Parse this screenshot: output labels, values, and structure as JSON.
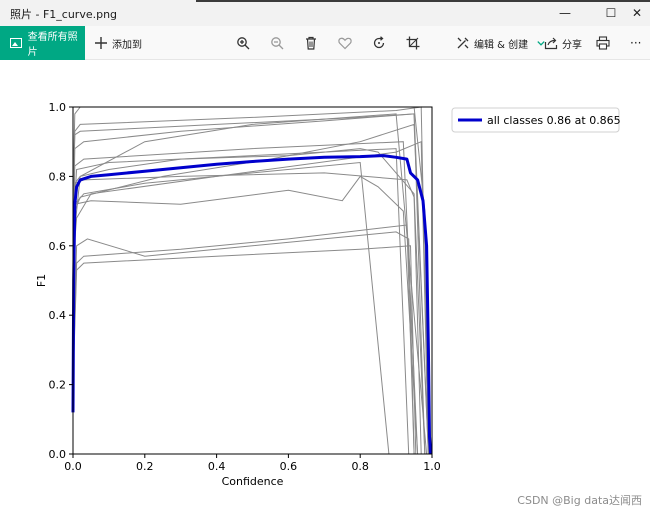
{
  "window": {
    "title": "照片 - F1_curve.png",
    "controls": {
      "minimize": "—",
      "maximize": "☐",
      "close": "✕"
    }
  },
  "toolbar": {
    "all_photos_label": "查看所有照片",
    "add_to_label": "添加到",
    "edit_create_label": "编辑 & 创建",
    "share_label": "分享",
    "more_label": "···",
    "accent": "#00a884",
    "icons": [
      "zoom-in-icon",
      "zoom-out-icon",
      "delete-icon",
      "heart-icon",
      "rotate-icon",
      "crop-icon",
      "edit-icon",
      "share-icon",
      "print-icon"
    ]
  },
  "chart_data": {
    "type": "line",
    "xlabel": "Confidence",
    "ylabel": "F1",
    "xlim": [
      0,
      1
    ],
    "ylim": [
      0,
      1
    ],
    "xticks": [
      "0.0",
      "0.2",
      "0.4",
      "0.6",
      "0.8",
      "1.0"
    ],
    "yticks": [
      "0.0",
      "0.2",
      "0.4",
      "0.6",
      "0.8",
      "1.0"
    ],
    "grid": false,
    "legend_position": "outside-top-right",
    "series": [
      {
        "name": "all classes 0.86 at 0.865",
        "color": "#0000cc",
        "x": [
          0.0,
          0.002,
          0.005,
          0.01,
          0.02,
          0.05,
          0.1,
          0.2,
          0.3,
          0.4,
          0.5,
          0.6,
          0.7,
          0.8,
          0.865,
          0.9,
          0.93,
          0.94,
          0.96,
          0.975,
          0.985,
          0.99,
          0.993,
          0.996
        ],
        "y": [
          0.12,
          0.5,
          0.72,
          0.77,
          0.79,
          0.8,
          0.805,
          0.815,
          0.825,
          0.835,
          0.843,
          0.85,
          0.855,
          0.857,
          0.86,
          0.855,
          0.85,
          0.81,
          0.79,
          0.73,
          0.6,
          0.3,
          0.05,
          0.0
        ]
      }
    ],
    "class_curves": {
      "color": "#8a8a8a",
      "lines": [
        {
          "x": [
            0.0,
            0.005,
            0.02,
            0.3,
            0.6,
            0.85,
            0.95,
            0.98,
            0.99
          ],
          "y": [
            0.75,
            0.98,
            1.0,
            1.0,
            1.0,
            1.0,
            1.0,
            0.7,
            0.0
          ]
        },
        {
          "x": [
            0.0,
            0.005,
            0.02,
            0.5,
            0.9,
            0.97,
            0.99
          ],
          "y": [
            0.7,
            0.93,
            0.95,
            0.97,
            0.99,
            1.0,
            0.0
          ]
        },
        {
          "x": [
            0.0,
            0.005,
            0.02,
            0.4,
            0.8,
            0.95,
            0.99
          ],
          "y": [
            0.7,
            0.92,
            0.93,
            0.95,
            0.97,
            0.98,
            0.0
          ]
        },
        {
          "x": [
            0.0,
            0.005,
            0.03,
            0.3,
            0.7,
            0.95,
            0.98
          ],
          "y": [
            0.6,
            0.88,
            0.9,
            0.93,
            0.96,
            0.98,
            0.0
          ]
        },
        {
          "x": [
            0.0,
            0.005,
            0.03,
            0.5,
            0.92,
            0.96
          ],
          "y": [
            0.55,
            0.83,
            0.85,
            0.88,
            0.9,
            0.0
          ]
        },
        {
          "x": [
            0.0,
            0.005,
            0.03,
            0.2,
            0.5,
            0.8,
            0.88
          ],
          "y": [
            0.5,
            0.72,
            0.75,
            0.78,
            0.81,
            0.84,
            0.0
          ]
        },
        {
          "x": [
            0.0,
            0.005,
            0.03,
            0.3,
            0.7,
            0.93,
            0.95,
            0.97
          ],
          "y": [
            0.45,
            0.78,
            0.79,
            0.8,
            0.81,
            0.79,
            0.74,
            0.0
          ]
        },
        {
          "x": [
            0.0,
            0.005,
            0.05,
            0.3,
            0.6,
            0.75,
            0.8,
            0.85,
            0.92,
            0.96
          ],
          "y": [
            0.35,
            0.72,
            0.73,
            0.72,
            0.76,
            0.73,
            0.8,
            0.77,
            0.7,
            0.0
          ]
        },
        {
          "x": [
            0.0,
            0.01,
            0.04,
            0.2,
            0.5,
            0.9,
            0.935,
            0.95
          ],
          "y": [
            0.25,
            0.6,
            0.62,
            0.57,
            0.6,
            0.64,
            0.62,
            0.0
          ]
        },
        {
          "x": [
            0.0,
            0.01,
            0.03,
            0.3,
            0.6,
            0.93,
            0.95
          ],
          "y": [
            0.22,
            0.55,
            0.57,
            0.59,
            0.62,
            0.66,
            0.0
          ]
        },
        {
          "x": [
            0.0,
            0.01,
            0.03,
            0.4,
            0.8,
            0.94,
            0.955
          ],
          "y": [
            0.2,
            0.53,
            0.55,
            0.57,
            0.59,
            0.6,
            0.0
          ]
        },
        {
          "x": [
            0.0,
            0.005,
            0.02,
            0.1,
            0.3,
            0.6,
            0.8,
            0.85,
            0.95,
            0.98
          ],
          "y": [
            0.5,
            0.65,
            0.8,
            0.82,
            0.85,
            0.86,
            0.88,
            0.87,
            0.75,
            0.0
          ]
        },
        {
          "x": [
            0.0,
            0.005,
            0.02,
            0.2,
            0.5,
            0.9,
            0.985
          ],
          "y": [
            0.6,
            0.78,
            0.8,
            0.9,
            0.95,
            0.98,
            0.0
          ]
        },
        {
          "x": [
            0.0,
            0.01,
            0.05,
            0.4,
            0.9,
            0.97,
            0.99
          ],
          "y": [
            0.55,
            0.68,
            0.75,
            0.8,
            0.87,
            0.9,
            0.0
          ]
        },
        {
          "x": [
            0.0,
            0.01,
            0.1,
            0.5,
            0.9,
            0.935
          ],
          "y": [
            0.65,
            0.82,
            0.84,
            0.86,
            0.88,
            0.0
          ]
        },
        {
          "x": [
            0.0,
            0.005,
            0.02,
            0.25,
            0.55,
            0.8,
            0.95,
            0.99
          ],
          "y": [
            0.4,
            0.7,
            0.74,
            0.8,
            0.85,
            0.9,
            0.95,
            0.0
          ]
        }
      ]
    }
  },
  "watermark": "CSDN @Big data达闻西"
}
